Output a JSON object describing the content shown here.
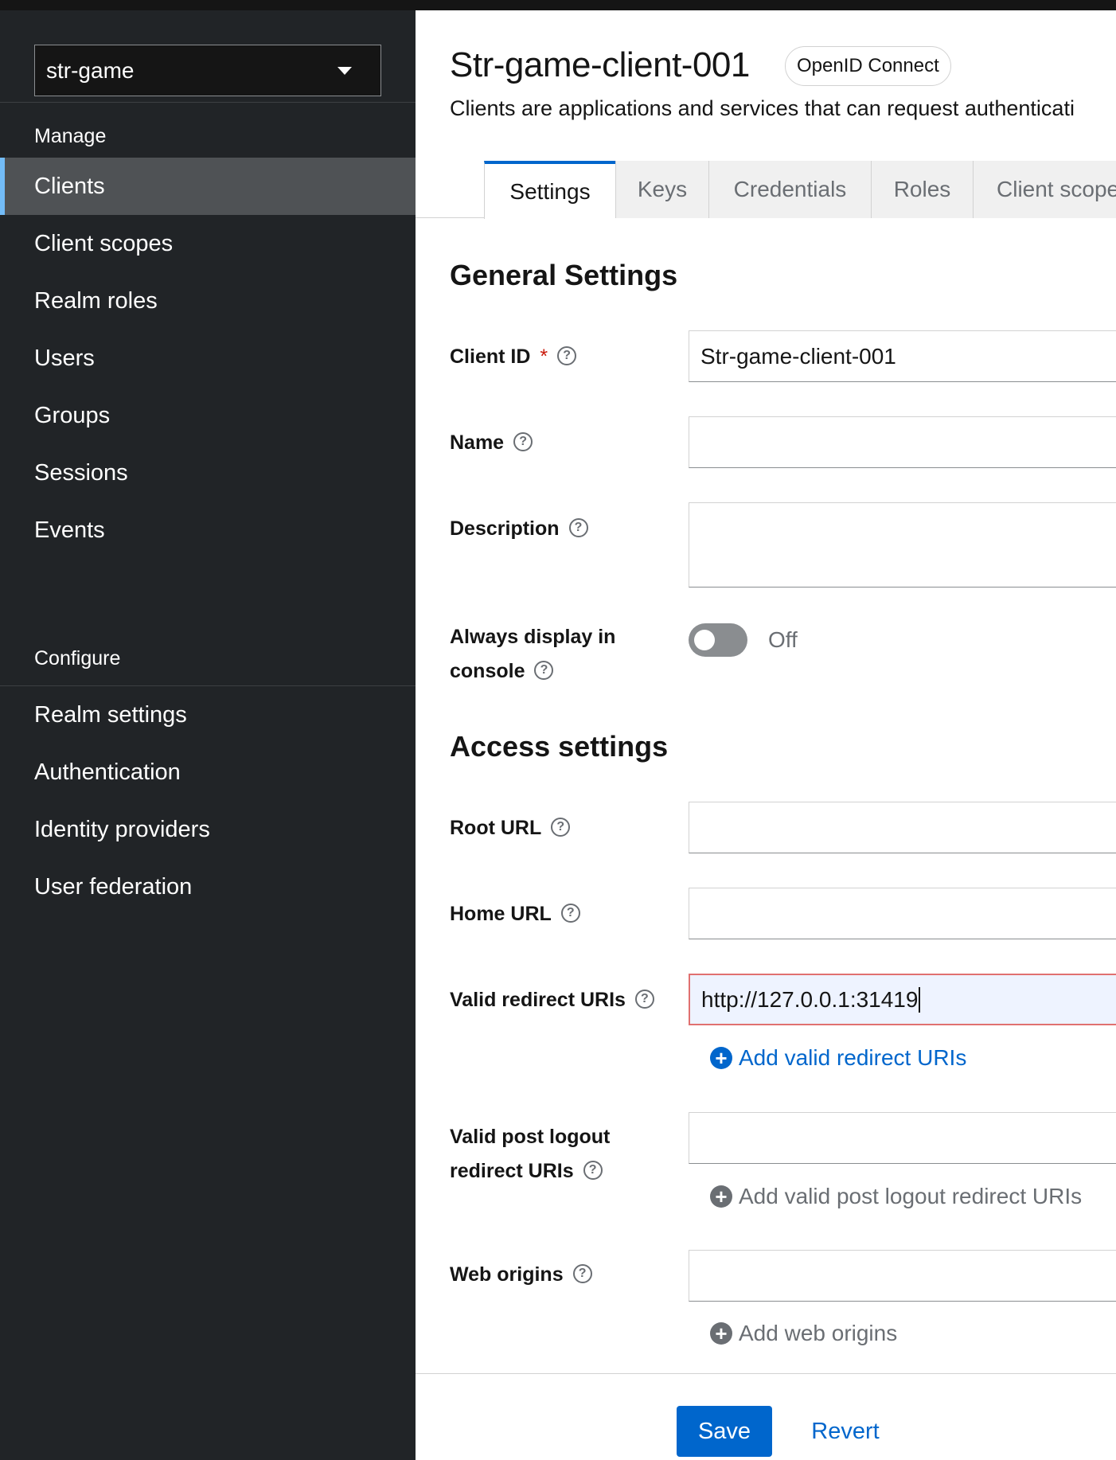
{
  "realm": {
    "selected": "str-game"
  },
  "sidebar": {
    "manage_title": "Manage",
    "manage_items": [
      {
        "label": "Clients"
      },
      {
        "label": "Client scopes"
      },
      {
        "label": "Realm roles"
      },
      {
        "label": "Users"
      },
      {
        "label": "Groups"
      },
      {
        "label": "Sessions"
      },
      {
        "label": "Events"
      }
    ],
    "configure_title": "Configure",
    "configure_items": [
      {
        "label": "Realm settings"
      },
      {
        "label": "Authentication"
      },
      {
        "label": "Identity providers"
      },
      {
        "label": "User federation"
      }
    ],
    "active_item": "Clients"
  },
  "header": {
    "title": "Str-game-client-001",
    "badge": "OpenID Connect",
    "description": "Clients are applications and services that can request authenticati"
  },
  "tabs": [
    {
      "label": "Settings"
    },
    {
      "label": "Keys"
    },
    {
      "label": "Credentials"
    },
    {
      "label": "Roles"
    },
    {
      "label": "Client scope"
    }
  ],
  "active_tab": "Settings",
  "general": {
    "heading": "General Settings",
    "client_id_label": "Client ID",
    "client_id_required": "*",
    "client_id_value": "Str-game-client-001",
    "name_label": "Name",
    "name_value": "",
    "description_label": "Description",
    "description_value": "",
    "always_display_label_1": "Always display in",
    "always_display_label_2": "console",
    "always_display_state": "Off"
  },
  "access": {
    "heading": "Access settings",
    "root_url_label": "Root URL",
    "root_url_value": "",
    "home_url_label": "Home URL",
    "home_url_value": "",
    "redirect_label": "Valid redirect URIs",
    "redirect_value": "http://127.0.0.1:31419",
    "add_redirect": "Add valid redirect URIs",
    "post_logout_label_1": "Valid post logout",
    "post_logout_label_2": "redirect URIs",
    "post_logout_value": "",
    "add_post_logout": "Add valid post logout redirect URIs",
    "web_origins_label": "Web origins",
    "web_origins_value": "",
    "add_web_origins": "Add web origins"
  },
  "footer": {
    "save": "Save",
    "revert": "Revert"
  },
  "icons": {
    "help": "question-circle-icon",
    "add": "plus-circle-icon",
    "dropdown": "caret-down-icon"
  },
  "colors": {
    "sidebar_bg": "#212427",
    "active_nav_bg": "#4f5255",
    "active_indicator": "#73bcf7",
    "primary": "#0066cc",
    "required": "#c9190b",
    "invalid_border": "#e07070"
  }
}
